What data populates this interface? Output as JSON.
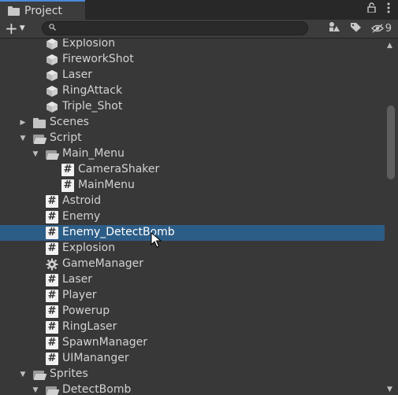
{
  "window": {
    "tab_label": "Project",
    "lock_icon": "lock-icon",
    "menu_icon": "kebab-menu-icon"
  },
  "toolbar": {
    "create_icon": "plus-icon",
    "search": {
      "placeholder": "",
      "value": ""
    },
    "hidden_count": "9"
  },
  "tree": {
    "items": [
      {
        "label": "Explosion",
        "type": "prefab",
        "depth": 2
      },
      {
        "label": "FireworkShot",
        "type": "prefab",
        "depth": 2
      },
      {
        "label": "Laser",
        "type": "prefab",
        "depth": 2
      },
      {
        "label": "RingAttack",
        "type": "prefab",
        "depth": 2
      },
      {
        "label": "Triple_Shot",
        "type": "prefab",
        "depth": 2
      },
      {
        "label": "Scenes",
        "type": "folder",
        "depth": 1,
        "expanded": false
      },
      {
        "label": "Script",
        "type": "folder",
        "depth": 1,
        "expanded": true
      },
      {
        "label": "Main_Menu",
        "type": "folder",
        "depth": 2,
        "expanded": true
      },
      {
        "label": "CameraShaker",
        "type": "script",
        "depth": 3
      },
      {
        "label": "MainMenu",
        "type": "script",
        "depth": 3
      },
      {
        "label": "Astroid",
        "type": "script",
        "depth": 2
      },
      {
        "label": "Enemy",
        "type": "script",
        "depth": 2
      },
      {
        "label": "Enemy_DetectBomb",
        "type": "script",
        "depth": 2,
        "selected": true
      },
      {
        "label": "Explosion",
        "type": "script",
        "depth": 2
      },
      {
        "label": "GameManager",
        "type": "gear",
        "depth": 2
      },
      {
        "label": "Laser",
        "type": "script",
        "depth": 2
      },
      {
        "label": "Player",
        "type": "script",
        "depth": 2
      },
      {
        "label": "Powerup",
        "type": "script",
        "depth": 2
      },
      {
        "label": "RingLaser",
        "type": "script",
        "depth": 2
      },
      {
        "label": "SpawnManager",
        "type": "script",
        "depth": 2
      },
      {
        "label": "UIMananger",
        "type": "script",
        "depth": 2
      },
      {
        "label": "Sprites",
        "type": "folder",
        "depth": 1,
        "expanded": true
      },
      {
        "label": "DetectBomb",
        "type": "folder",
        "depth": 2,
        "expanded": true
      }
    ]
  },
  "colors": {
    "selection": "#2c5d87",
    "background": "#383838",
    "accent": "#4a8ad8"
  }
}
